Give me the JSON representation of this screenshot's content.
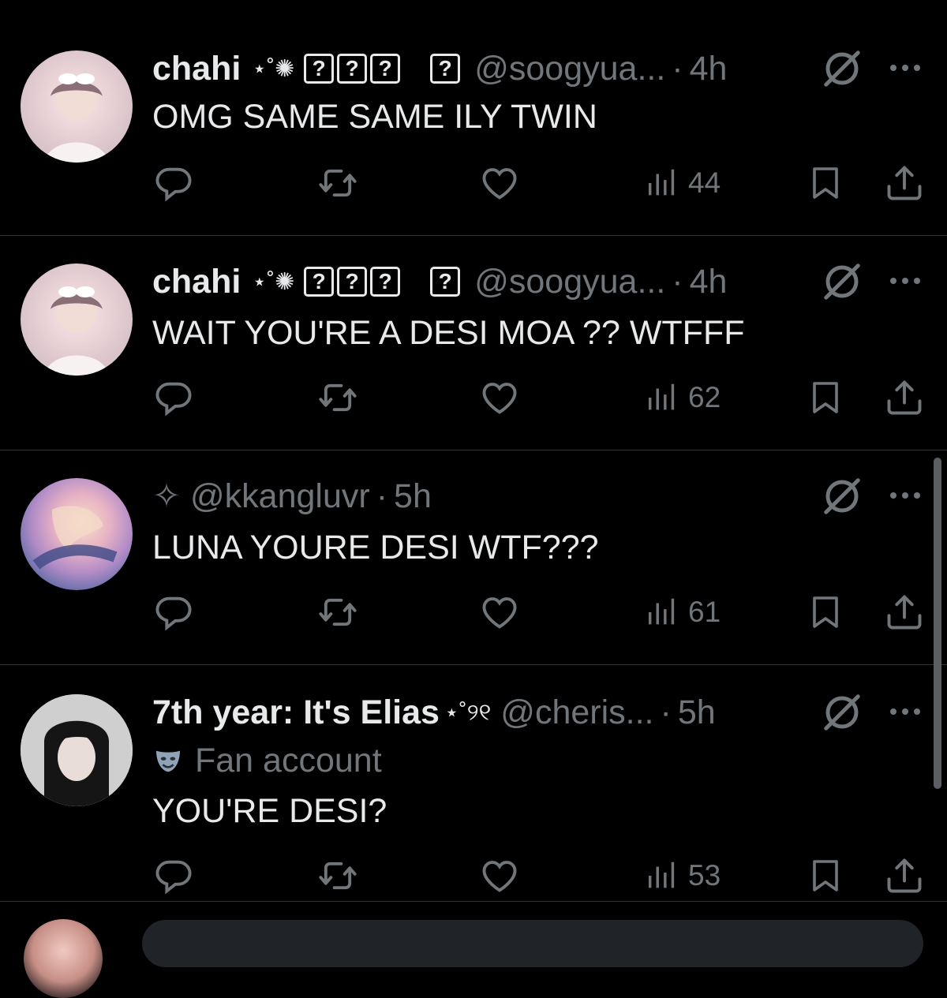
{
  "tweets": [
    {
      "name": "chahi",
      "deco": "⋆˚✺",
      "boxes": [
        "?",
        "?",
        "?",
        "?"
      ],
      "extra_box": "?",
      "handle": "@soogyua...",
      "dot": "·",
      "time": "4h",
      "badge": "",
      "text": "OMG SAME SAME ILY TWIN",
      "views": "44",
      "avatar": "pink-avatar"
    },
    {
      "name": "chahi",
      "deco": "⋆˚✺",
      "boxes": [
        "?",
        "?",
        "?",
        "?"
      ],
      "extra_box": "?",
      "handle": "@soogyua...",
      "dot": "·",
      "time": "4h",
      "badge": "",
      "text": "WAIT YOU'RE A DESI MOA ?? WTFFF",
      "views": "62",
      "avatar": "pink-avatar"
    },
    {
      "name": "✧",
      "handle": "@kkangluvr",
      "dot": "·",
      "time": "5h",
      "text": "LUNA YOURE DESI WTF???",
      "views": "61",
      "avatar": "pastel-avatar"
    },
    {
      "name": "7th year: It's Elias",
      "deco": "⋆˚୨୧",
      "handle": "@cheris...",
      "dot": "·",
      "time": "5h",
      "badge": "Fan account",
      "text": "YOU'RE DESI?",
      "views": "53",
      "avatar": "dark-hair-avatar"
    }
  ],
  "colors": {
    "background": "#000000",
    "text": "#e7e9ea",
    "muted": "#71767b",
    "divider": "#2f3336"
  }
}
